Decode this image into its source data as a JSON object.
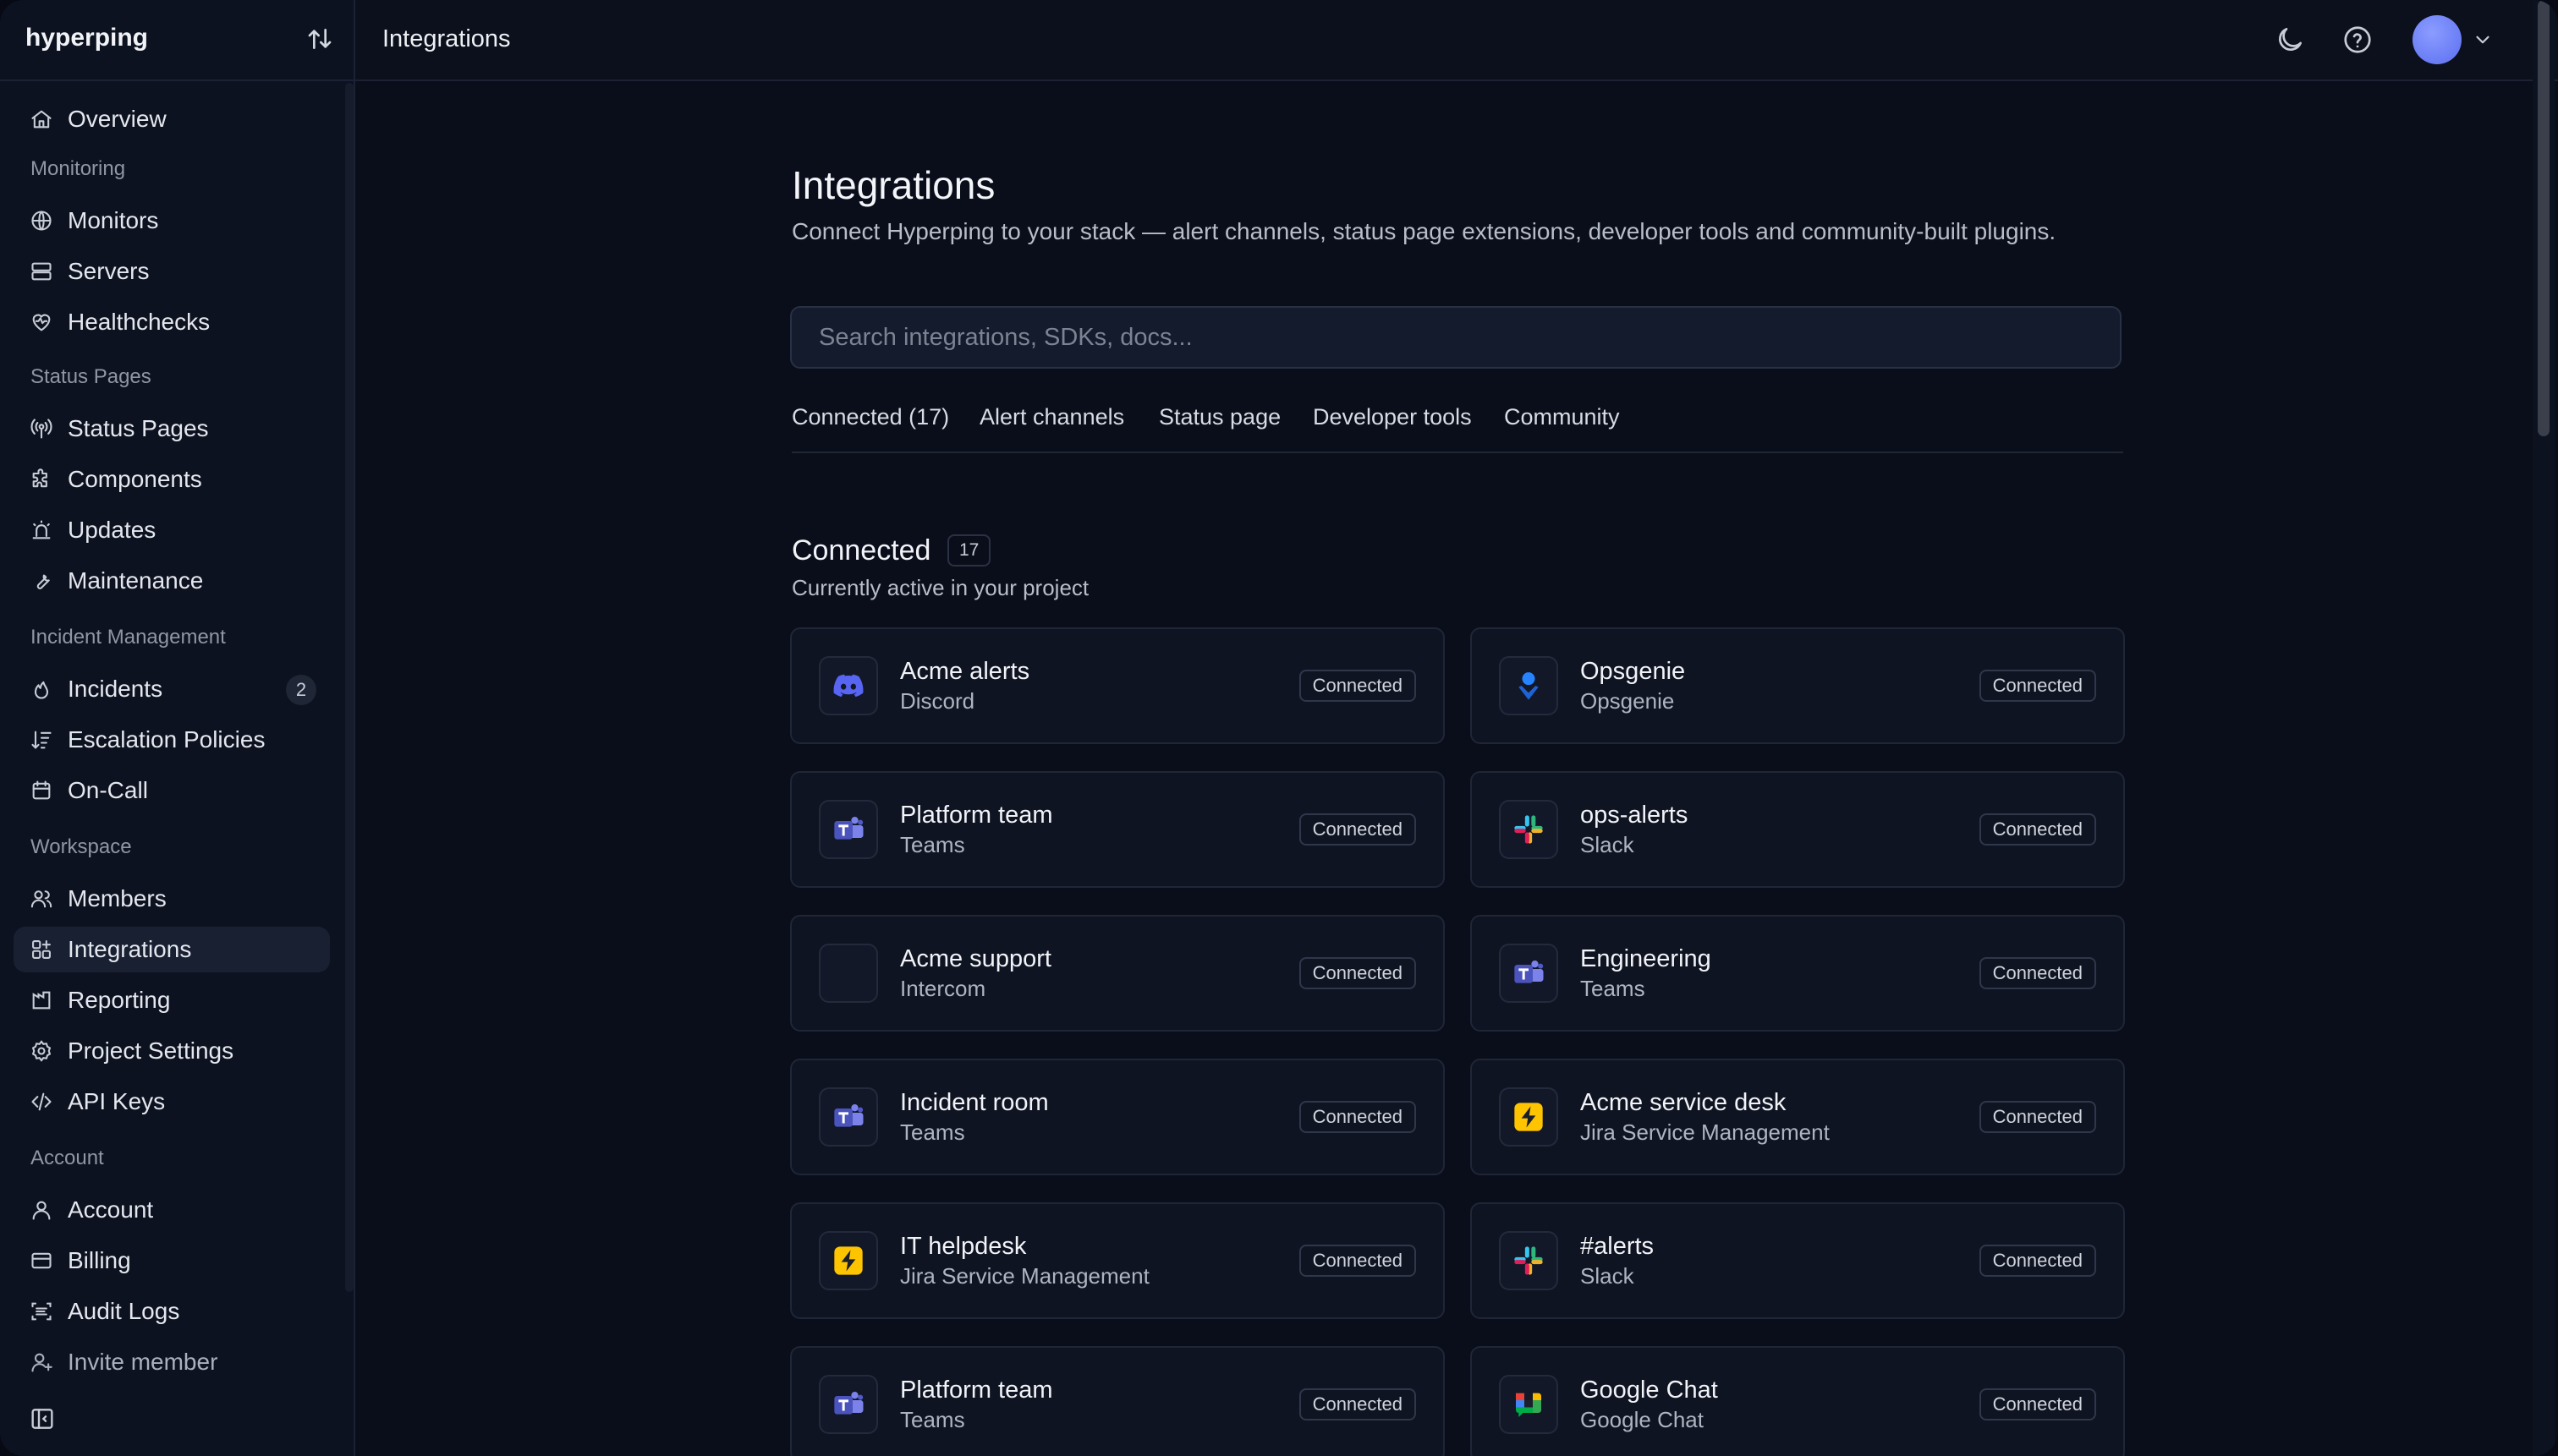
{
  "sidebar": {
    "brand": "hyperping",
    "overview": "Overview",
    "sections": {
      "monitoring": "Monitoring",
      "status_pages": "Status Pages",
      "incident_management": "Incident Management",
      "workspace": "Workspace",
      "account": "Account"
    },
    "items": {
      "monitors": "Monitors",
      "servers": "Servers",
      "healthchecks": "Healthchecks",
      "status_pages": "Status Pages",
      "components": "Components",
      "updates": "Updates",
      "maintenance": "Maintenance",
      "incidents": "Incidents",
      "incidents_badge": "2",
      "escalation_policies": "Escalation Policies",
      "on_call": "On-Call",
      "members": "Members",
      "integrations": "Integrations",
      "reporting": "Reporting",
      "project_settings": "Project Settings",
      "api_keys": "API Keys",
      "account": "Account",
      "billing": "Billing",
      "audit_logs": "Audit Logs",
      "invite_member": "Invite member"
    }
  },
  "topbar": {
    "title": "Integrations"
  },
  "page": {
    "title": "Integrations",
    "description": "Connect Hyperping to your stack — alert channels, status page extensions, developer tools and community-built plugins.",
    "search_placeholder": "Search integrations, SDKs, docs...",
    "tabs": [
      "Connected (17)",
      "Alert channels",
      "Status page",
      "Developer tools",
      "Community"
    ],
    "section": {
      "title": "Connected",
      "count": "17",
      "subtitle": "Currently active in your project"
    },
    "status_label": "Connected",
    "cards": [
      {
        "name": "Acme alerts",
        "service": "Discord",
        "icon": "discord-icon"
      },
      {
        "name": "Opsgenie",
        "service": "Opsgenie",
        "icon": "opsgenie-icon"
      },
      {
        "name": "Platform team",
        "service": "Teams",
        "icon": "teams-icon"
      },
      {
        "name": "ops-alerts",
        "service": "Slack",
        "icon": "slack-icon"
      },
      {
        "name": "Acme support",
        "service": "Intercom",
        "icon": "intercom-icon"
      },
      {
        "name": "Engineering",
        "service": "Teams",
        "icon": "teams-icon"
      },
      {
        "name": "Incident room",
        "service": "Teams",
        "icon": "teams-icon"
      },
      {
        "name": "Acme service desk",
        "service": "Jira Service Management",
        "icon": "jira-icon"
      },
      {
        "name": "IT helpdesk",
        "service": "Jira Service Management",
        "icon": "jira-icon"
      },
      {
        "name": "#alerts",
        "service": "Slack",
        "icon": "slack-icon"
      },
      {
        "name": "Platform team",
        "service": "Teams",
        "icon": "teams-icon"
      },
      {
        "name": "Google Chat",
        "service": "Google Chat",
        "icon": "google-chat-icon"
      }
    ]
  },
  "colors": {
    "background": "#0a0e1a",
    "sidebar": "#0d1220",
    "active_item": "#182032",
    "avatar": "#6f80f7"
  }
}
